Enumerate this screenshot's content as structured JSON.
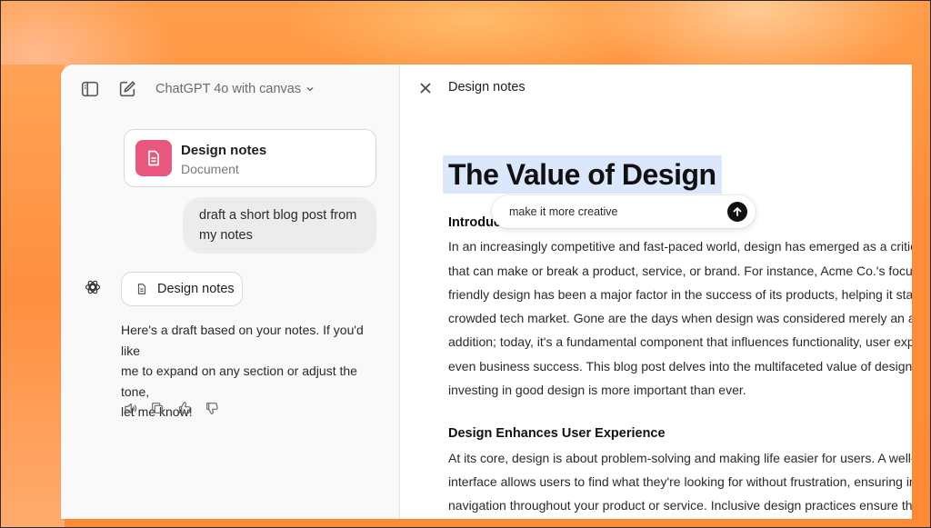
{
  "chat": {
    "model_label": "ChatGPT 4o with canvas",
    "doc_card": {
      "title": "Design notes",
      "subtitle": "Document"
    },
    "user_message_lines": [
      "draft a short blog post from",
      "my notes"
    ],
    "doc_pill_label": "Design notes",
    "assistant_message_lines": [
      "Here's a draft based on your notes. If you'd like",
      "me to expand on any section or adjust the tone,",
      "let me know!"
    ]
  },
  "canvas": {
    "title": "Design notes",
    "heading": "The Value of Design",
    "inline_prompt": "make it more creative",
    "section1_heading": "Introduc",
    "section1_lines": [
      "In an increasingly competitive and fast-paced world, design has emerged as a critic",
      "that can make or break a product, service, or brand. For instance, Acme Co.'s focus c",
      "friendly design has been a major factor in the success of its products, helping it star",
      "crowded tech market. Gone are the days when design was considered merely an ae",
      "addition; today, it's a fundamental component that influences functionality, user exp",
      "even business success. This blog post delves into the multifaceted value of design a",
      "investing in good design is more important than ever."
    ],
    "section2_heading": "Design Enhances User Experience",
    "section2_lines": [
      "At its core, design is about problem-solving and making life easier for users. A well-c",
      "interface allows users to find what they're looking for without frustration, ensuring in",
      "navigation throughout your product or service. Inclusive design practices ensure tha"
    ]
  },
  "icons": {
    "sidebar_toggle": "sidebar-toggle-icon",
    "new_chat": "new-chat-icon",
    "close": "close-icon",
    "document": "document-icon",
    "assistant": "openai-logo-icon",
    "send": "arrow-up-icon",
    "read_aloud": "speaker-icon",
    "copy": "copy-icon",
    "thumbs_up": "thumbs-up-icon",
    "thumbs_down": "thumbs-down-icon"
  },
  "colors": {
    "accent_pink": "#e8577d",
    "highlight_blue": "#dbe7fb",
    "background_orange": "#ff8e3c"
  }
}
